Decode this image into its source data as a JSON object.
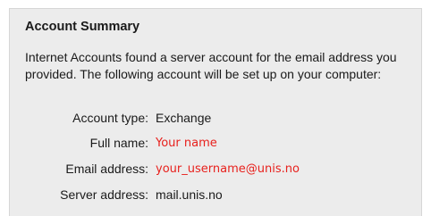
{
  "summary": {
    "title": "Account Summary",
    "message": "Internet Accounts found a server account for the email address you provided. The following account will be set up on your computer:"
  },
  "fields": [
    {
      "label": "Account type:",
      "value": "Exchange"
    },
    {
      "label": "Full name:",
      "value": "Your name"
    },
    {
      "label": "Email address:",
      "value": "your_username@unis.no"
    },
    {
      "label": "Server address:",
      "value": "mail.unis.no"
    }
  ],
  "colors": {
    "panel_background": "#ececec",
    "highlight_text": "#e8211d"
  }
}
